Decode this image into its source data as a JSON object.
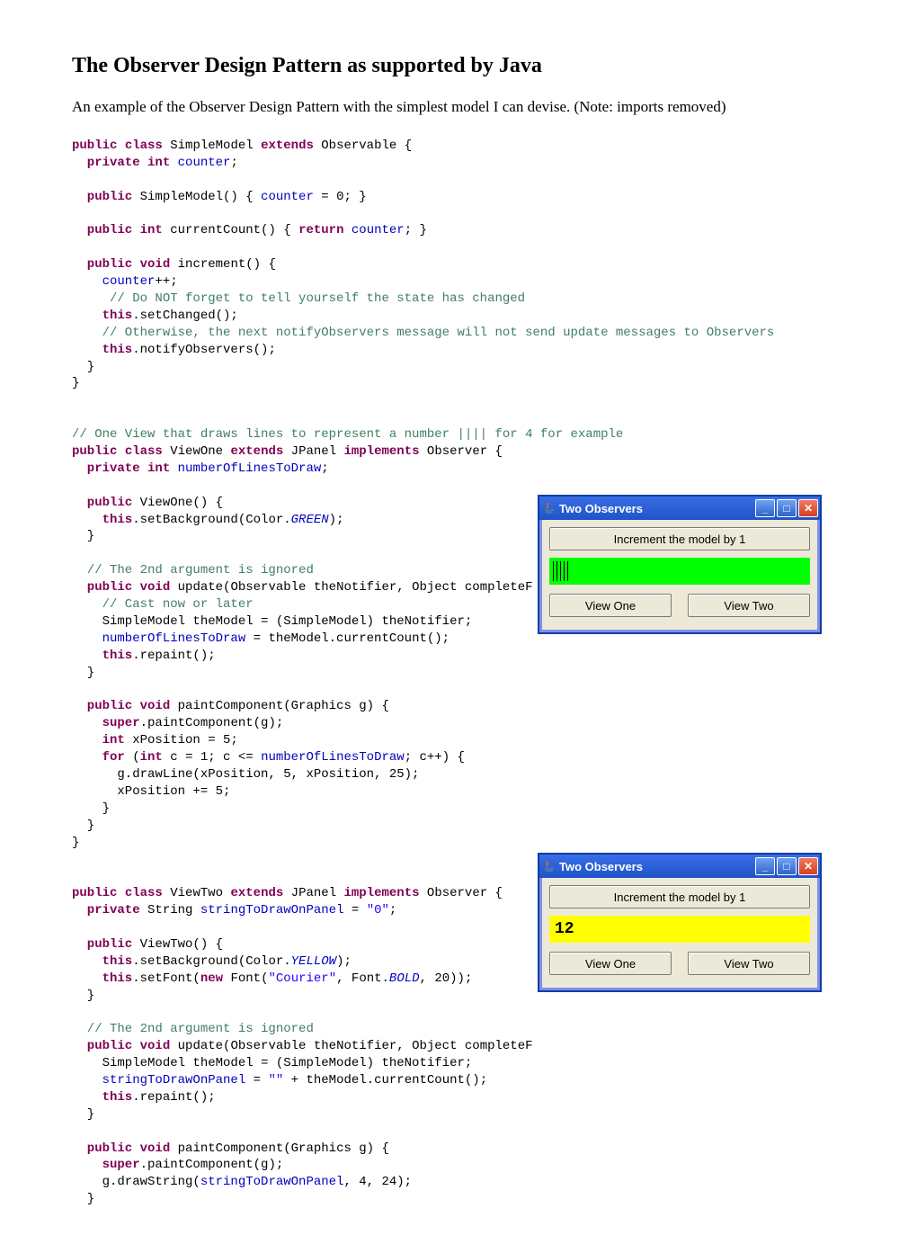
{
  "heading": "The Observer Design Pattern as supported by Java",
  "intro": "An example of the Observer Design Pattern with the simplest model I can devise. (Note: imports removed)",
  "code": {
    "l01a": "public",
    "l01b": " class",
    "l01c": " SimpleModel ",
    "l01d": "extends",
    "l01e": " Observable {",
    "l02a": "  private",
    "l02b": " int",
    "l02c": " counter",
    "l02d": ";",
    "l03a": "  public",
    "l03b": " SimpleModel() { ",
    "l03c": "counter",
    "l03d": " = 0; }",
    "l04a": "  public",
    "l04b": " int",
    "l04c": " currentCount() { ",
    "l04d": "return",
    "l04e": " counter",
    "l04f": "; }",
    "l05a": "  public",
    "l05b": " void",
    "l05c": " increment() {",
    "l06a": "    counter",
    "l06b": "++;",
    "l07": "     // Do NOT forget to tell yourself the state has changed",
    "l08a": "    this",
    "l08b": ".setChanged();",
    "l09": "    // Otherwise, the next notifyObservers message will not send update messages to Observers",
    "l10a": "    this",
    "l10b": ".notifyObservers();",
    "l11": "  }",
    "l12": "}",
    "l13": "// One View that draws lines to represent a number |||| for 4 for example",
    "l14a": "public",
    "l14b": " class",
    "l14c": " ViewOne ",
    "l14d": "extends",
    "l14e": " JPanel ",
    "l14f": "implements",
    "l14g": " Observer {",
    "l15a": "  private",
    "l15b": " int",
    "l15c": " numberOfLinesToDraw",
    "l15d": ";",
    "l16a": "  public",
    "l16b": " ViewOne() {",
    "l17a": "    this",
    "l17b": ".setBackground(Color.",
    "l17c": "GREEN",
    "l17d": ");",
    "l18": "  }",
    "l19": "  // The 2nd argument is ignored",
    "l20a": "  public",
    "l20b": " void",
    "l20c": " update(Observable theNotifier, Object completeF",
    "l21": "    // Cast now or later",
    "l22": "    SimpleModel theModel = (SimpleModel) theNotifier;",
    "l23a": "    numberOfLinesToDraw",
    "l23b": " = theModel.currentCount();",
    "l24a": "    this",
    "l24b": ".repaint();",
    "l25": "  }",
    "l26a": "  public",
    "l26b": " void",
    "l26c": " paintComponent(Graphics g) {",
    "l27a": "    super",
    "l27b": ".paintComponent(g);",
    "l28a": "    int",
    "l28b": " xPosition = 5;",
    "l29a": "    for",
    "l29b": " (",
    "l29c": "int",
    "l29d": " c = 1; c <= ",
    "l29e": "numberOfLinesToDraw",
    "l29f": "; c++) {",
    "l30": "      g.drawLine(xPosition, 5, xPosition, 25);",
    "l31": "      xPosition += 5;",
    "l32": "    }",
    "l33": "  }",
    "l34": "}",
    "l35a": "public",
    "l35b": " class",
    "l35c": " ViewTwo ",
    "l35d": "extends",
    "l35e": " JPanel ",
    "l35f": "implements",
    "l35g": " Observer {",
    "l36a": "  private",
    "l36b": " String ",
    "l36c": "stringToDrawOnPanel",
    "l36d": " = ",
    "l36e": "\"0\"",
    "l36f": ";",
    "l37a": "  public",
    "l37b": " ViewTwo() {",
    "l38a": "    this",
    "l38b": ".setBackground(Color.",
    "l38c": "YELLOW",
    "l38d": ");",
    "l39a": "    this",
    "l39b": ".setFont(",
    "l39c": "new",
    "l39d": " Font(",
    "l39e": "\"Courier\"",
    "l39f": ", Font.",
    "l39g": "BOLD",
    "l39h": ", 20));",
    "l40": "  }",
    "l41": "  // The 2nd argument is ignored",
    "l42a": "  public",
    "l42b": " void",
    "l42c": " update(Observable theNotifier, Object completeF",
    "l43": "    SimpleModel theModel = (SimpleModel) theNotifier;",
    "l44a": "    stringToDrawOnPanel",
    "l44b": " = ",
    "l44c": "\"\"",
    "l44d": " + theModel.currentCount();",
    "l45a": "    this",
    "l45b": ".repaint();",
    "l46": "  }",
    "l47a": "  public",
    "l47b": " void",
    "l47c": " paintComponent(Graphics g) {",
    "l48a": "    super",
    "l48b": ".paintComponent(g);",
    "l49a": "    g.drawString(",
    "l49b": "stringToDrawOnPanel",
    "l49c": ", 4, 24);",
    "l50": "  }"
  },
  "win1": {
    "title": "Two Observers",
    "increment": "Increment the model by 1",
    "viewOne": "View One",
    "viewTwo": "View Two",
    "lineCount": 5
  },
  "win2": {
    "title": "Two Observers",
    "increment": "Increment the model by 1",
    "viewOne": "View One",
    "viewTwo": "View Two",
    "value": "12"
  }
}
